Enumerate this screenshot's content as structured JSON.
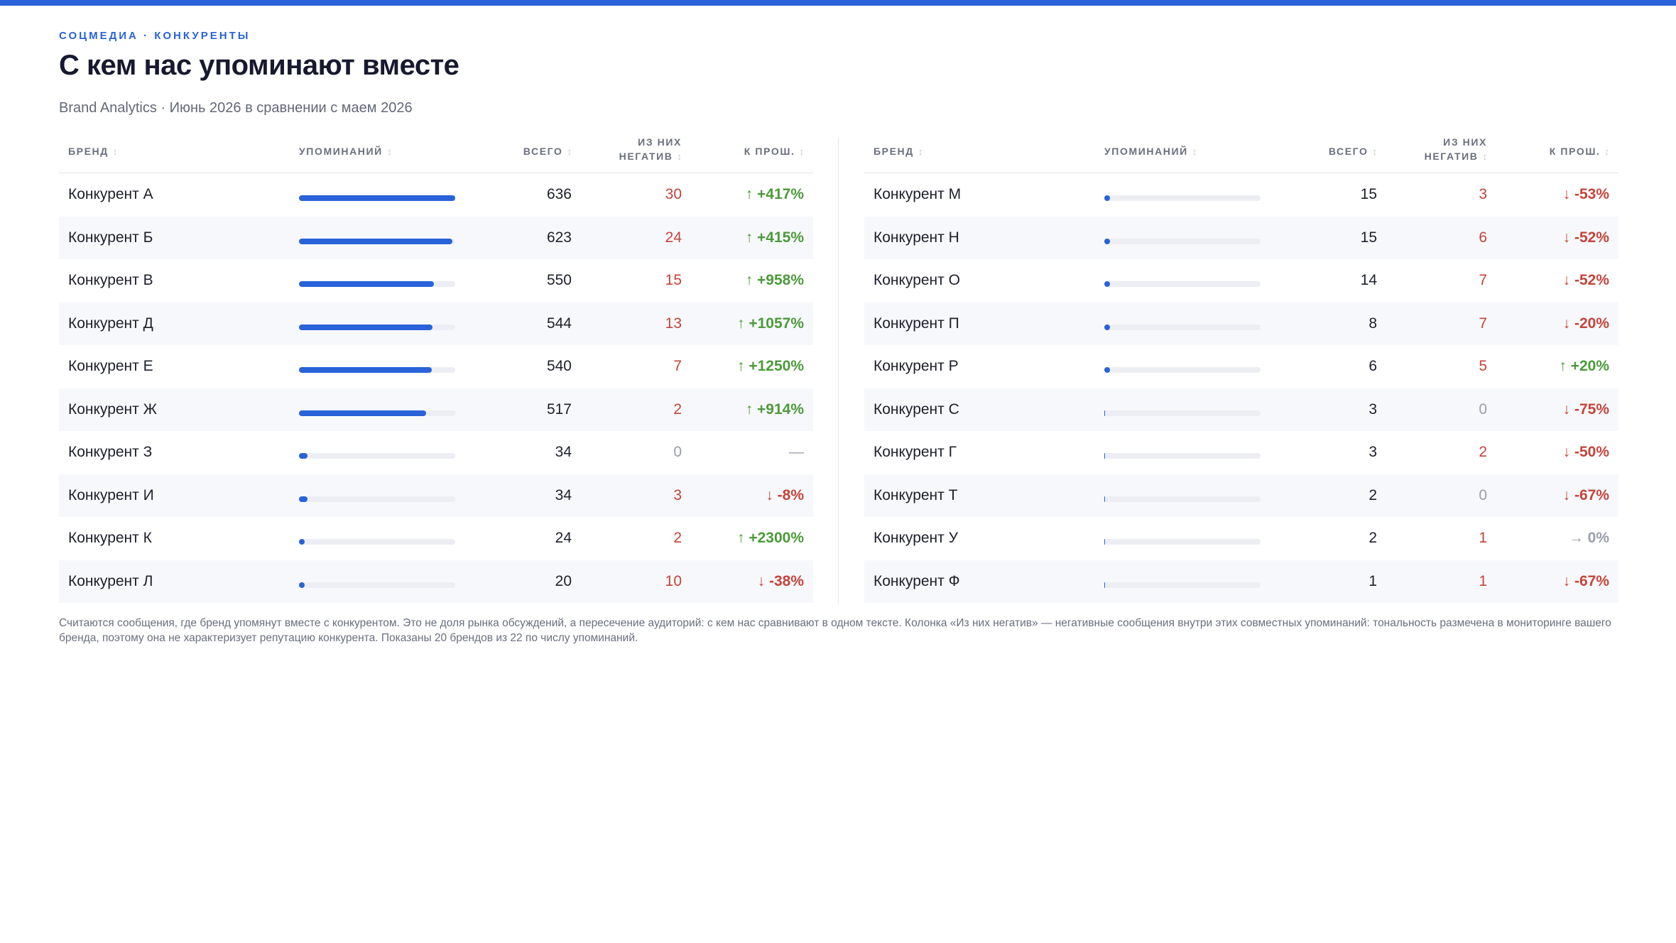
{
  "header": {
    "eyebrow": "СОЦМЕДИА · КОНКУРЕНТЫ",
    "title": "С кем нас упоминают вместе",
    "subtitle": "Brand Analytics · Июнь 2026 в сравнении с маем 2026"
  },
  "columns": {
    "brand": "БРЕНД",
    "mentions": "УПОМИНАНИЙ",
    "total": "ВСЕГО",
    "negative_line1": "ИЗ НИХ",
    "negative_line2": "НЕГАТИВ",
    "change": "К ПРОШ.",
    "sort_glyph": "↕"
  },
  "colors": {
    "accent": "#2962d9",
    "positive": "#4c9a3a",
    "negative": "#c4443a",
    "neutral": "#9a9eab"
  },
  "bar_scale_max": 636,
  "left_rows": [
    {
      "brand": "Конкурент А",
      "total": 636,
      "negative": 30,
      "change": "↑ +417%",
      "dir": "up"
    },
    {
      "brand": "Конкурент Б",
      "total": 623,
      "negative": 24,
      "change": "↑ +415%",
      "dir": "up"
    },
    {
      "brand": "Конкурент В",
      "total": 550,
      "negative": 15,
      "change": "↑ +958%",
      "dir": "up"
    },
    {
      "brand": "Конкурент Д",
      "total": 544,
      "negative": 13,
      "change": "↑ +1057%",
      "dir": "up"
    },
    {
      "brand": "Конкурент Е",
      "total": 540,
      "negative": 7,
      "change": "↑ +1250%",
      "dir": "up"
    },
    {
      "brand": "Конкурент Ж",
      "total": 517,
      "negative": 2,
      "change": "↑ +914%",
      "dir": "up"
    },
    {
      "brand": "Конкурент З",
      "total": 34,
      "negative": 0,
      "change": "—",
      "dir": "none"
    },
    {
      "brand": "Конкурент И",
      "total": 34,
      "negative": 3,
      "change": "↓ -8%",
      "dir": "down"
    },
    {
      "brand": "Конкурент К",
      "total": 24,
      "negative": 2,
      "change": "↑ +2300%",
      "dir": "up"
    },
    {
      "brand": "Конкурент Л",
      "total": 20,
      "negative": 10,
      "change": "↓ -38%",
      "dir": "down"
    }
  ],
  "right_rows": [
    {
      "brand": "Конкурент М",
      "total": 15,
      "negative": 3,
      "change": "↓ -53%",
      "dir": "down"
    },
    {
      "brand": "Конкурент Н",
      "total": 15,
      "negative": 6,
      "change": "↓ -52%",
      "dir": "down"
    },
    {
      "brand": "Конкурент О",
      "total": 14,
      "negative": 7,
      "change": "↓ -52%",
      "dir": "down"
    },
    {
      "brand": "Конкурент П",
      "total": 8,
      "negative": 7,
      "change": "↓ -20%",
      "dir": "down"
    },
    {
      "brand": "Конкурент Р",
      "total": 6,
      "negative": 5,
      "change": "↑ +20%",
      "dir": "up"
    },
    {
      "brand": "Конкурент С",
      "total": 3,
      "negative": 0,
      "change": "↓ -75%",
      "dir": "down"
    },
    {
      "brand": "Конкурент Г",
      "total": 3,
      "negative": 2,
      "change": "↓ -50%",
      "dir": "down"
    },
    {
      "brand": "Конкурент Т",
      "total": 2,
      "negative": 0,
      "change": "↓ -67%",
      "dir": "down"
    },
    {
      "brand": "Конкурент У",
      "total": 2,
      "negative": 1,
      "change": "→ 0%",
      "dir": "flat"
    },
    {
      "brand": "Конкурент Ф",
      "total": 1,
      "negative": 1,
      "change": "↓ -67%",
      "dir": "down"
    }
  ],
  "footnote": "Считаются сообщения, где бренд упомянут вместе с конкурентом. Это не доля рынка обсуждений, а пересечение аудиторий: с кем нас сравнивают в одном тексте. Колонка «Из них негатив» — негативные сообщения внутри этих совместных упоминаний: тональность размечена в мониторинге вашего бренда, поэтому она не характеризует репутацию конкурента. Показаны 20 брендов из 22 по числу упоминаний."
}
